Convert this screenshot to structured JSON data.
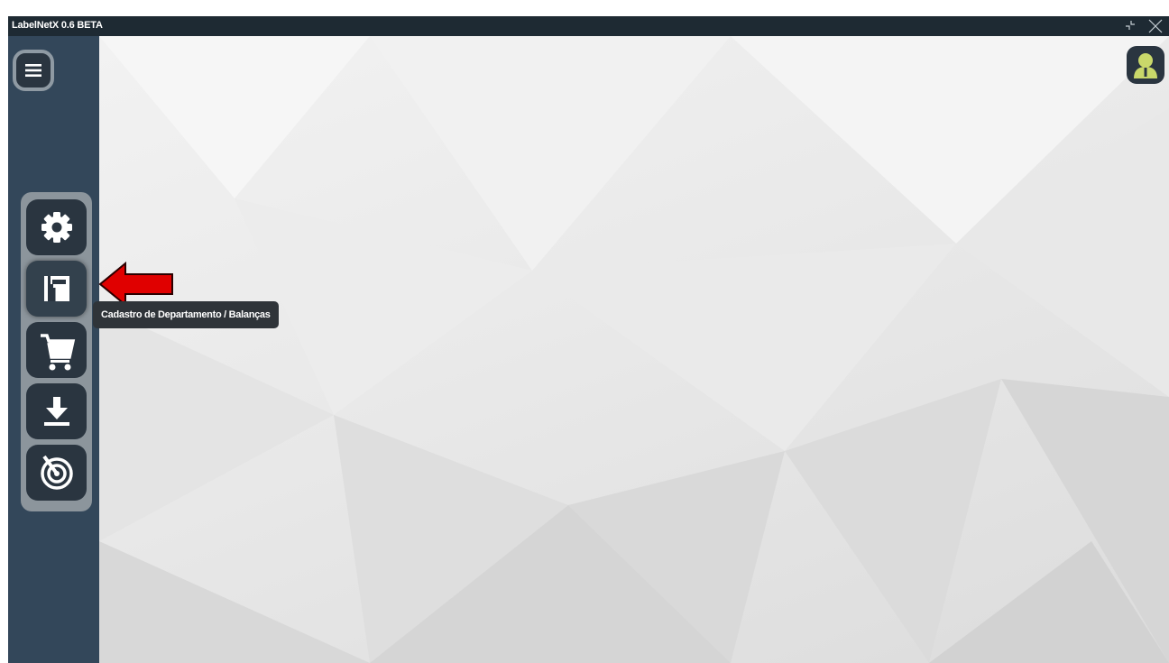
{
  "doc_heading": "",
  "window": {
    "title": "LabelNetX 0.6 BETA"
  },
  "window_controls": {
    "restore_icon": "restore-icon",
    "close_icon": "close-icon"
  },
  "sidebar": {
    "menu_icon": "hamburger-menu-icon",
    "items": [
      {
        "name": "settings",
        "icon": "gear-icon"
      },
      {
        "name": "departments",
        "icon": "layout-grid-icon",
        "tooltip": "Cadastro de Departamento / Balanças"
      },
      {
        "name": "cart",
        "icon": "shopping-cart-icon"
      },
      {
        "name": "download",
        "icon": "download-icon"
      },
      {
        "name": "radar",
        "icon": "radar-icon"
      }
    ]
  },
  "user": {
    "icon": "user-avatar-icon"
  },
  "colors": {
    "titlebar": "#1e2a33",
    "sidebar": "#33475a",
    "button": "#2a3540",
    "panel": "#8c959c",
    "annotation_arrow": "#e00000",
    "user_accent": "#c9d86a"
  }
}
